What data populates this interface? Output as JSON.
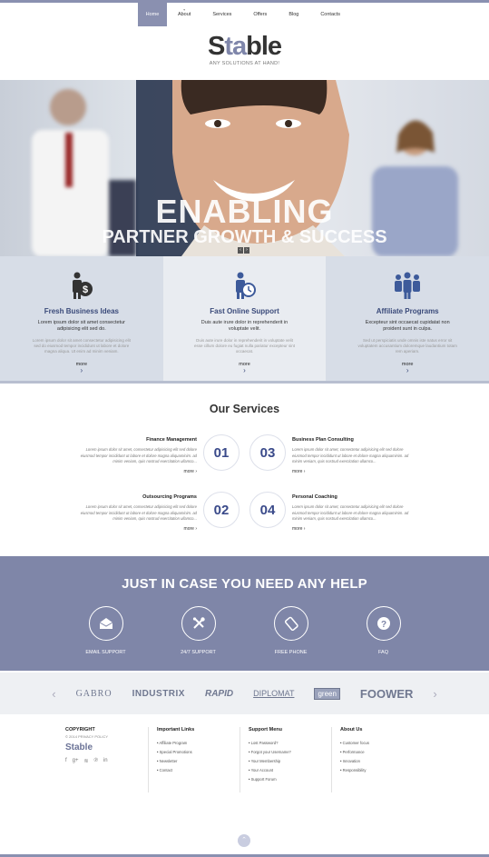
{
  "nav": {
    "items": [
      "Home",
      "About",
      "Services",
      "Offers",
      "Blog",
      "Contacts"
    ]
  },
  "logo": {
    "brand_pre": "S",
    "brand_accent": "ta",
    "brand_post": "ble",
    "tagline": "ANY SOLUTIONS AT HAND!"
  },
  "hero": {
    "line1": "ENABLING",
    "line2": "PARTNER GROWTH & SUCCESS"
  },
  "features": [
    {
      "title": "Fresh Business Ideas",
      "text": "Lorem ipsum dolor sit amet consectetur adipisicing elit sed do.",
      "sub": "Lorem ipsum dolor sit amet consectetur adipisicing elit sed do eiusmod tempor incididunt ut labore et dolore magna aliqua. Ut enim ad minim veniam.",
      "more": "more"
    },
    {
      "title": "Fast Online Support",
      "text": "Duis aute irure dolor in reprehenderit in voluptate velit.",
      "sub": "Duis aute irure dolor in reprehenderit in voluptate velit esse cillum dolore eu fugiat nulla pariatur excepteur sint occaecat.",
      "more": "more"
    },
    {
      "title": "Affiliate Programs",
      "text": "Excepteur sint occaecat cupidatat non proident sunt in culpa.",
      "sub": "Sed ut perspiciatis unde omnis iste natus error sit voluptatem accusantium doloremque laudantium totam rem aperiam.",
      "more": "more"
    }
  ],
  "services": {
    "title": "Our Services",
    "items": [
      {
        "num": "01",
        "title": "Finance Management",
        "text": "Lorem ipsum dolor sit amet, consectetur adipisicing elit sed dolore eiusmod tempor incididunt ut labore et dolore magna aliquaminim. ad minim veniam, quis nostrud exercitation ullamco...",
        "more": "more ›"
      },
      {
        "num": "03",
        "title": "Business Plan Consulting",
        "text": "Lorem ipsum dolor sit amet, consectetur adipisicing elit sed dolore eiusmod tempor incididunt ut labore et dolore magna aliquaminim. ad minim veniam, quis nostrud exercitation ullamco...",
        "more": "more ›"
      },
      {
        "num": "02",
        "title": "Outsourcing Programs",
        "text": "Lorem ipsum dolor sit amet, consectetur adipisicing elit sed dolore eiusmod tempor incididunt ut labore et dolore magna aliquaminim. ad minim veniam, quis nostrud exercitation ullamco...",
        "more": "more ›"
      },
      {
        "num": "04",
        "title": "Personal Coaching",
        "text": "Lorem ipsum dolor sit amet, consectetur adipisicing elit sed dolore eiusmod tempor incididunt ut labore et dolore magna aliquaminim. ad minim veniam, quis nostrud exercitation ullamco...",
        "more": "more ›"
      }
    ]
  },
  "help": {
    "title": "JUST IN CASE YOU NEED ANY HELP",
    "items": [
      "EMAIL SUPPORT",
      "24/7 SUPPORT",
      "FREE PHONE",
      "FAQ"
    ]
  },
  "partners": [
    "GABRO",
    "INDUSTRIX",
    "RAPID",
    "DIPLOMAT",
    "green",
    "FOOWER"
  ],
  "footer": {
    "copyright": "COPYRIGHT",
    "copy_sub": "© 2014 PRIVACY POLICY",
    "brand": "Stable",
    "cols": [
      {
        "title": "Important Links",
        "items": [
          "Affiliate Program",
          "Special Promotions",
          "Newsletter",
          "Contact"
        ]
      },
      {
        "title": "Support Menu",
        "items": [
          "Lost Password?",
          "Forgot your Username?",
          "Your Membership",
          "Your Account",
          "Support Forum"
        ]
      },
      {
        "title": "About Us",
        "items": [
          "Customer focus",
          "Performance",
          "Innovation",
          "Responsibility"
        ]
      }
    ]
  },
  "colors": {
    "accent": "#7f86a8",
    "title_blue": "#3a4a7a"
  }
}
